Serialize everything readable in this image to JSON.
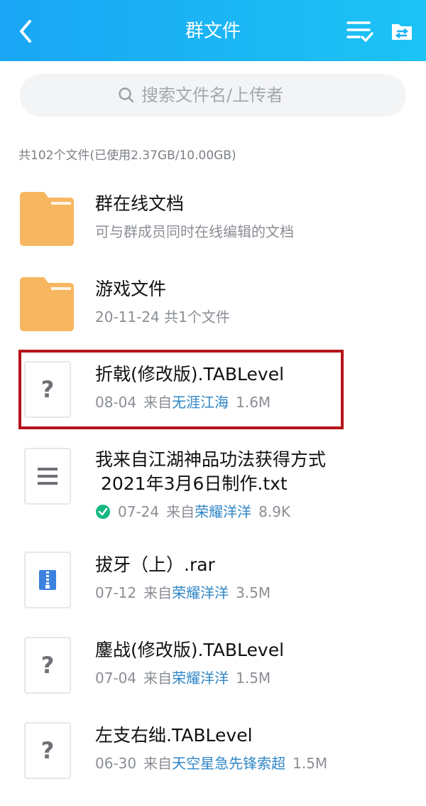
{
  "header": {
    "title": "群文件"
  },
  "search": {
    "placeholder": "搜索文件名/上传者"
  },
  "summary": "共102个文件(已使用2.37GB/10.00GB)",
  "items": [
    {
      "name": "群在线文档",
      "meta": "可与群成员同时在线编辑的文档",
      "type": "folder"
    },
    {
      "name": "游戏文件",
      "meta": "20-11-24  共1个文件",
      "type": "folder"
    },
    {
      "name": "折戟(修改版).TABLevel",
      "date": "08-04",
      "from": "来自",
      "uploader": "无涯江海",
      "size": "1.6M",
      "type": "unknown"
    },
    {
      "name_line1": "我来自江湖神品功法获得方式",
      "name_line2": " 2021年3月6日制作.txt",
      "date": "07-24",
      "from": "来自",
      "uploader": "荣耀洋洋",
      "size": "8.9K",
      "type": "text"
    },
    {
      "name": "拔牙（上）.rar",
      "date": "07-12",
      "from": "来自",
      "uploader": "荣耀洋洋",
      "size": "3.5M",
      "type": "archive"
    },
    {
      "name": "鏖战(修改版).TABLevel",
      "date": "07-04",
      "from": "来自",
      "uploader": "荣耀洋洋",
      "size": "1.5M",
      "type": "unknown"
    },
    {
      "name": "左支右绌.TABLevel",
      "date": "06-30",
      "from": "来自",
      "uploader": "天空星急先锋索超",
      "size": "1.5M",
      "type": "unknown"
    }
  ],
  "colors": {
    "header_start": "#1aa6f5",
    "header_end": "#1cc3f4",
    "folder": "#f7b760",
    "uploader_link": "#2f86c6",
    "highlight": "#b5141a",
    "downloaded_check": "#14b883"
  },
  "icons": [
    "back-arrow-icon",
    "sort-list-icon",
    "file-transfer-icon",
    "search-icon",
    "folder-icon",
    "unknown-file-icon",
    "text-file-icon",
    "archive-file-icon",
    "downloaded-check-icon"
  ]
}
